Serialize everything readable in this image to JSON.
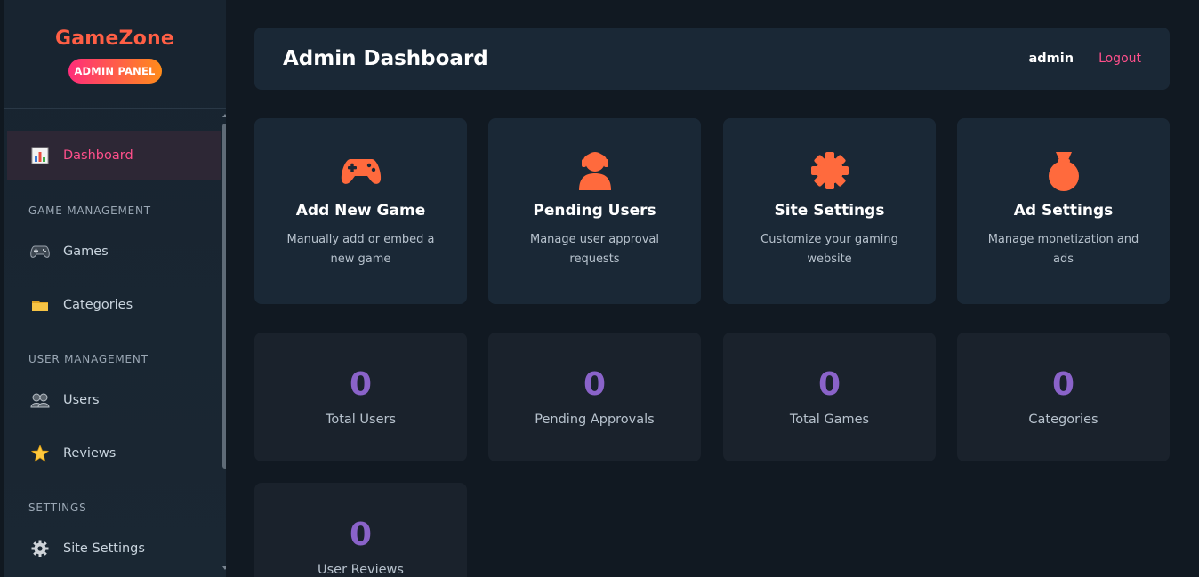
{
  "sidebar": {
    "brand": "GameZone",
    "badge": "ADMIN PANEL",
    "items": [
      {
        "label": "Dashboard",
        "icon": "bar-chart-icon"
      },
      {
        "label": "Games",
        "icon": "gamepad-icon"
      },
      {
        "label": "Categories",
        "icon": "folder-icon"
      },
      {
        "label": "Users",
        "icon": "users-icon"
      },
      {
        "label": "Reviews",
        "icon": "star-icon"
      },
      {
        "label": "Site Settings",
        "icon": "gear-icon"
      }
    ],
    "sections": [
      "GAME MANAGEMENT",
      "USER MANAGEMENT",
      "SETTINGS"
    ]
  },
  "header": {
    "title": "Admin Dashboard",
    "user": "admin",
    "logout": "Logout"
  },
  "actions": [
    {
      "title": "Add New Game",
      "desc": "Manually add or embed a new game",
      "icon": "gamepad-icon"
    },
    {
      "title": "Pending Users",
      "desc": "Manage user approval requests",
      "icon": "user-icon"
    },
    {
      "title": "Site Settings",
      "desc": "Customize your gaming website",
      "icon": "gear-icon"
    },
    {
      "title": "Ad Settings",
      "desc": "Manage monetization and ads",
      "icon": "money-bag-icon"
    }
  ],
  "stats": [
    {
      "value": "0",
      "label": "Total Users"
    },
    {
      "value": "0",
      "label": "Pending Approvals"
    },
    {
      "value": "0",
      "label": "Total Games"
    },
    {
      "value": "0",
      "label": "Categories"
    },
    {
      "value": "0",
      "label": "User Reviews"
    }
  ],
  "colors": {
    "accent": "#ff5f45",
    "active": "#ff4f8b",
    "stat": "#8a63c9",
    "card": "#1a2836",
    "background": "#111922"
  }
}
